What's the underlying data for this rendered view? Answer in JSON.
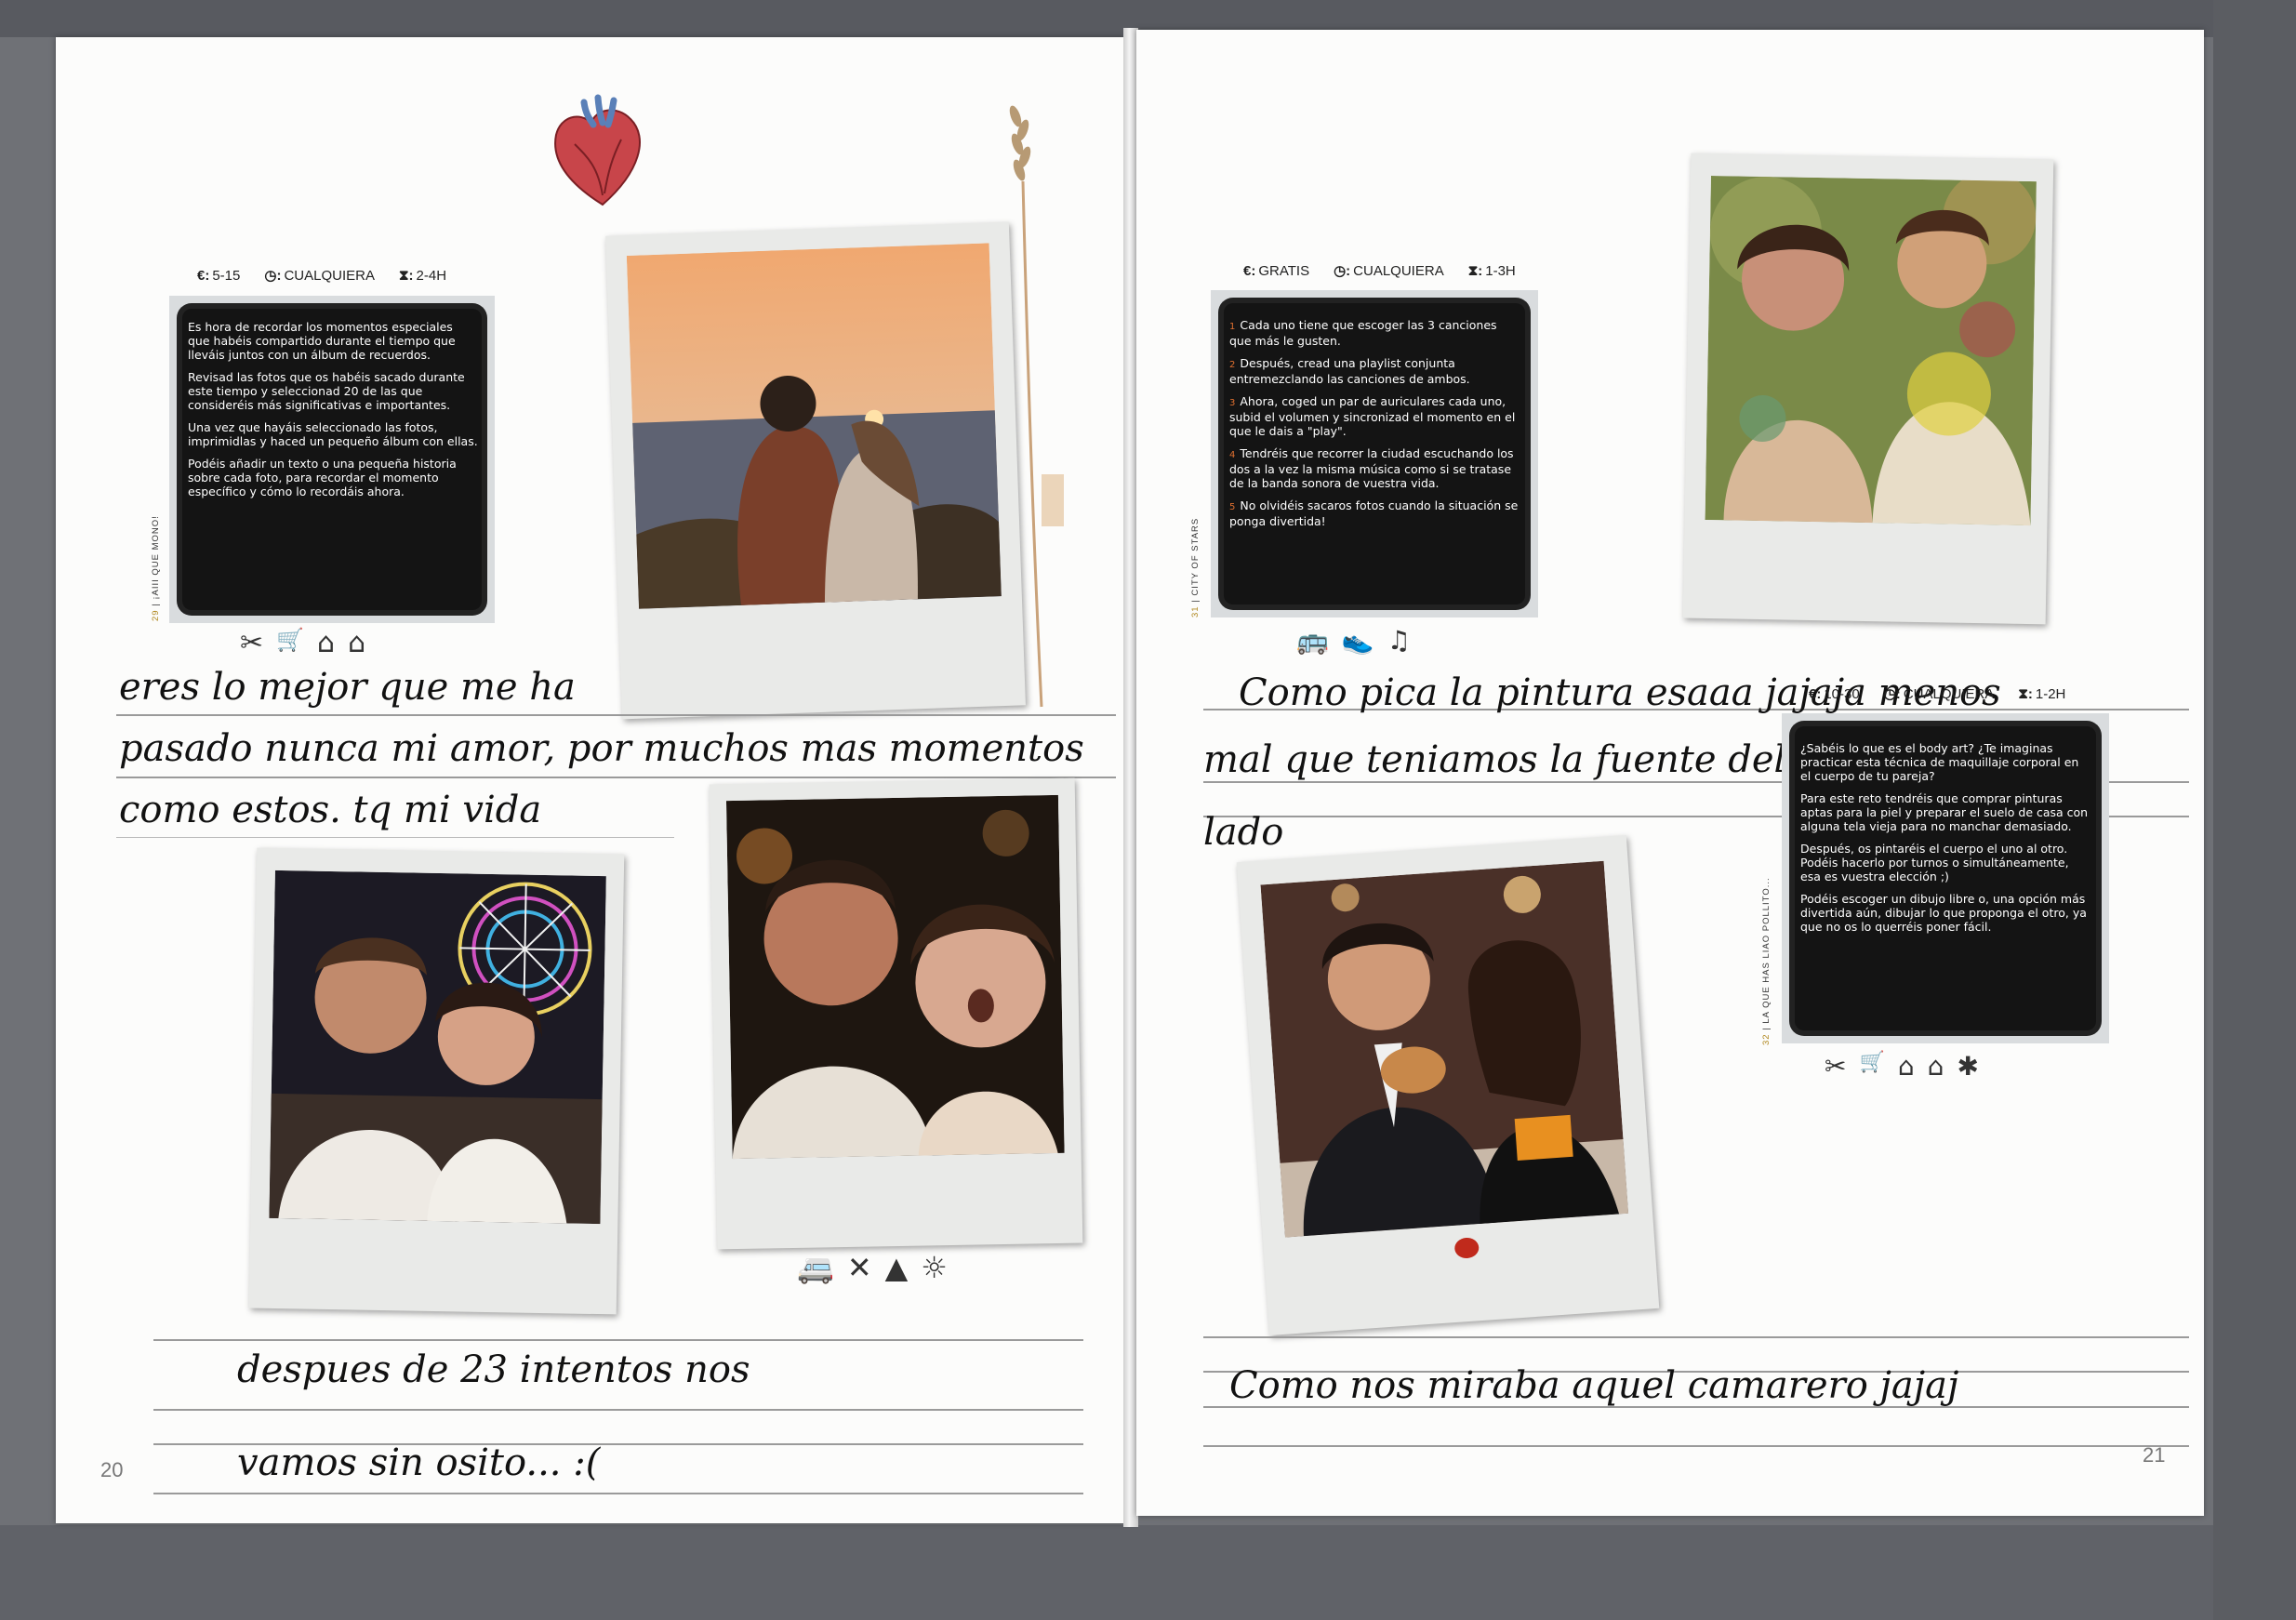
{
  "spread": {
    "left_page": {
      "page_number": "20",
      "activity": {
        "number": "29",
        "title": "¡AIII QUE MONO!",
        "cost": "5-15",
        "when": "CUALQUIERA",
        "duration": "2-4H",
        "paragraphs": [
          "Es hora de recordar los momentos especiales que habéis compartido durante el tiempo que lleváis juntos con un álbum de recuerdos.",
          "Revisad las fotos que os habéis sacado durante este tiempo y seleccionad 20 de las que consideréis más significativas e importantes.",
          "Una vez que hayáis seleccionado las fotos, imprimidlas y haced un pequeño álbum con ellas.",
          "Podéis añadir un texto o una pequeña historia sobre cada foto, para recordar el momento específico y cómo lo recordáis ahora."
        ],
        "icons": [
          "scissors-icon",
          "cart-icon",
          "home-icon",
          "home-heart-icon"
        ],
        "icon_glyphs": [
          "✂",
          "🛒",
          "⌂",
          "⌂"
        ]
      },
      "note_top": [
        "eres lo mejor que me ha",
        "pasado nunca mi amor, por muchos mas momentos",
        "como estos. tq mi vida"
      ],
      "note_bottom": [
        "despues de 23 intentos nos",
        "vamos sin osito... :("
      ],
      "middle_icons": [
        "van-icon",
        "utensils-icon",
        "mountain-icon",
        "sun-icon"
      ],
      "middle_icon_glyphs": [
        "🚐",
        "✕",
        "▲",
        "☼"
      ]
    },
    "right_page": {
      "page_number": "21",
      "activity_top": {
        "number": "31",
        "title": "CITY OF STARS",
        "cost": "GRATIS",
        "when": "CUALQUIERA",
        "duration": "1-3H",
        "paragraphs": [
          "Cada uno tiene que escoger las 3 canciones que más le gusten.",
          "Después, cread una playlist conjunta entremezclando las canciones de ambos.",
          "Ahora, coged un par de auriculares cada uno, subid el volumen y sincronizad el momento en el que le dais a \"play\".",
          "Tendréis que recorrer la ciudad escuchando los dos a la vez la misma música como si se tratase de la banda sonora de vuestra vida.",
          "No olvidéis sacaros fotos cuando la situación se ponga divertida!"
        ],
        "steps": [
          "1",
          "2",
          "3",
          "4",
          "5"
        ],
        "icons": [
          "bus-icon",
          "sneaker-icon",
          "music-icon"
        ],
        "icon_glyphs": [
          "🚌",
          "👟",
          "♫"
        ]
      },
      "activity_bottom": {
        "number": "32",
        "title": "LA QUE HAS LIAO POLLITO...",
        "cost": "10-30",
        "when": "CUALQUIERA",
        "duration": "1-2H",
        "paragraphs": [
          "¿Sabéis lo que es el body art? ¿Te imaginas practicar esta técnica de maquillaje corporal en el cuerpo de tu pareja?",
          "Para este reto tendréis que comprar pinturas aptas para la piel y preparar el suelo de casa con alguna tela vieja para no manchar demasiado.",
          "Después, os pintaréis el cuerpo el uno al otro. Podéis hacerlo por turnos o simultáneamente, esa es vuestra elección ;)",
          "Podéis escoger un dibujo libre o, una opción más divertida aún, dibujar lo que proponga el otro, ya que no os lo querréis poner fácil."
        ],
        "icons": [
          "scissors-icon",
          "cart-icon",
          "home-icon",
          "home-heart-icon",
          "paint-splat-icon"
        ],
        "icon_glyphs": [
          "✂",
          "🛒",
          "⌂",
          "⌂",
          "✱"
        ]
      },
      "note_top": [
        "Como pica la pintura esaaa jajaja menos",
        "mal que teniamos la fuente del pueblo al",
        "lado"
      ],
      "note_bottom": [
        "Como nos miraba aquel camarero jajaj"
      ]
    }
  },
  "meta_icons": {
    "cost": "€:",
    "time": "◷:",
    "duration": "⧗:"
  },
  "colors": {
    "page": "#fcfcfb",
    "card": "#d9dcde",
    "scribble": "#141414",
    "accent_number": "#b08820"
  }
}
